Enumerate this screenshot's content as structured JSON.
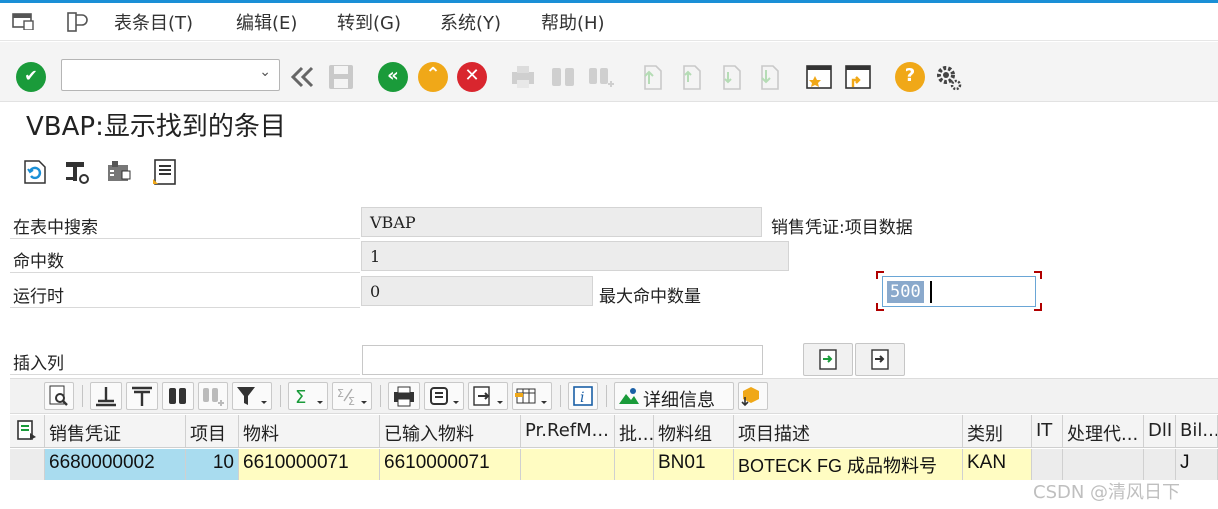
{
  "menu": {
    "items": [
      "表条目(T)",
      "编辑(E)",
      "转到(G)",
      "系统(Y)",
      "帮助(H)"
    ]
  },
  "toolbar": {
    "command_field_value": "",
    "icons": [
      "enter-check-icon",
      "command-dropdown-icon",
      "rewind-icon",
      "save-icon",
      "back-icon",
      "exit-icon",
      "cancel-icon",
      "print-icon",
      "find-icon",
      "find-next-icon",
      "first-page-icon",
      "previous-page-icon",
      "next-page-icon",
      "last-page-icon",
      "new-session-icon",
      "shortcut-icon",
      "help-icon",
      "settings-gear-icon"
    ],
    "colors": {
      "enter": "#1a9b3a",
      "back": "#1a9b3a",
      "exit": "#f0a818",
      "cancel": "#d9262e",
      "help": "#f0a818"
    }
  },
  "page": {
    "title": "VBAP:显示找到的条目"
  },
  "form": {
    "search_table_label": "在表中搜索",
    "search_table_value": "VBAP",
    "table_description": "销售凭证:项目数据",
    "hits_label": "命中数",
    "hits_value": "1",
    "runtime_label": "运行时",
    "runtime_value": "0",
    "max_hits_label": "最大命中数量",
    "max_hits_value": "500",
    "insert_column_label": "插入列",
    "insert_column_value": ""
  },
  "alv": {
    "details_label": "详细信息"
  },
  "table": {
    "headers": [
      "销售凭证",
      "项目",
      "物料",
      "已输入物料",
      "Pr.RefM...",
      "批...",
      "物料组",
      "项目描述",
      "类别",
      "IT",
      "处理代...",
      "DlI",
      "Bil..."
    ],
    "rows": [
      [
        "6680000002",
        "10",
        "6610000071",
        "6610000071",
        "",
        "",
        "BN01",
        "BOTECK FG 成品物料号",
        "KAN",
        "",
        "",
        "",
        "J"
      ]
    ]
  },
  "watermark": "CSDN @清风日下"
}
